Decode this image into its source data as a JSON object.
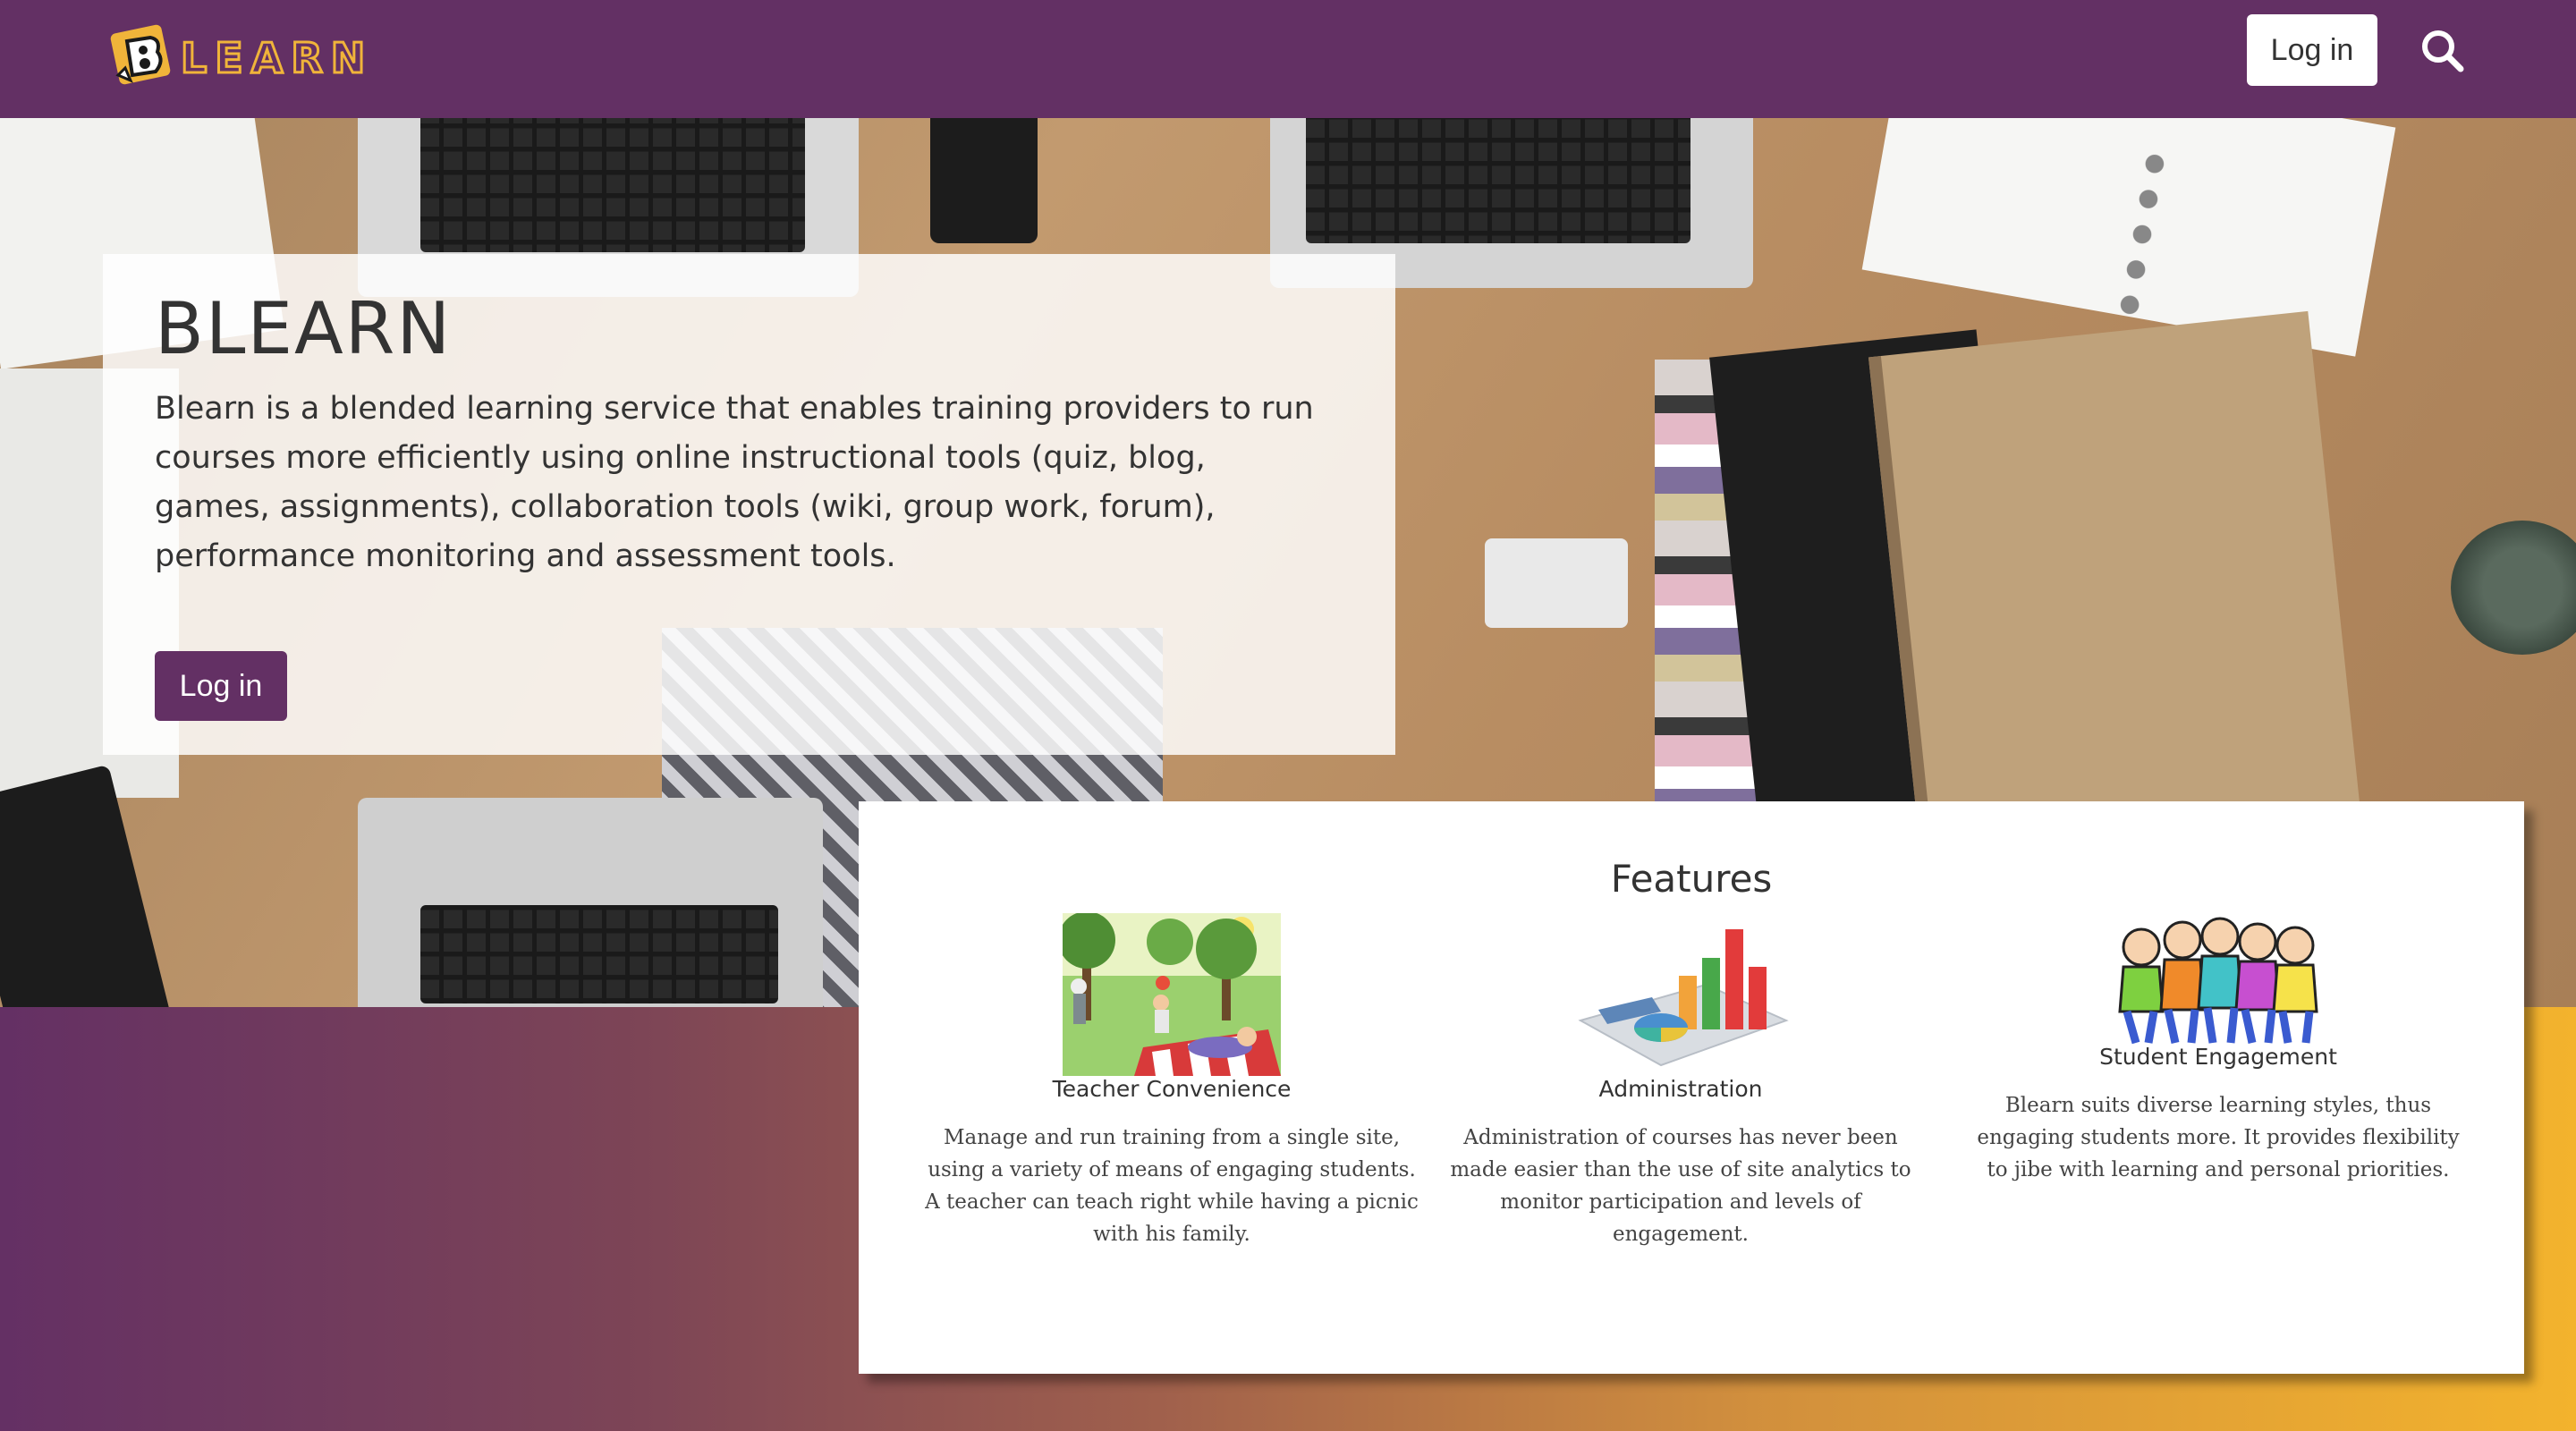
{
  "header": {
    "logo_text": "LEARN",
    "login_label": "Log in",
    "search_icon": "search-icon"
  },
  "intro": {
    "title": "BLEARN",
    "description": "Blearn is a blended learning service that enables training providers to run courses more efficiently using online instructional tools (quiz, blog, games, assignments), collaboration tools (wiki, group work, forum), performance monitoring and assessment tools.",
    "login_label": "Log in"
  },
  "features": {
    "heading": "Features",
    "items": [
      {
        "name": "Teacher Convenience",
        "description": "Manage and run training from a single site, using a variety of means of engaging students. A teacher can teach right while having a picnic with his family.",
        "image": "picnic-illustration"
      },
      {
        "name": "Administration",
        "description": "Administration of courses has never been made easier than the use of site analytics to monitor participation and levels of engagement.",
        "image": "analytics-chart-illustration"
      },
      {
        "name": "Student Engagement",
        "description": "Blearn suits diverse learning styles, thus engaging students more. It provides flexibility to jibe with learning and personal priorities.",
        "image": "students-group-illustration"
      }
    ]
  },
  "colors": {
    "brand_purple": "#633064",
    "accent_gold": "#f0b43a"
  }
}
